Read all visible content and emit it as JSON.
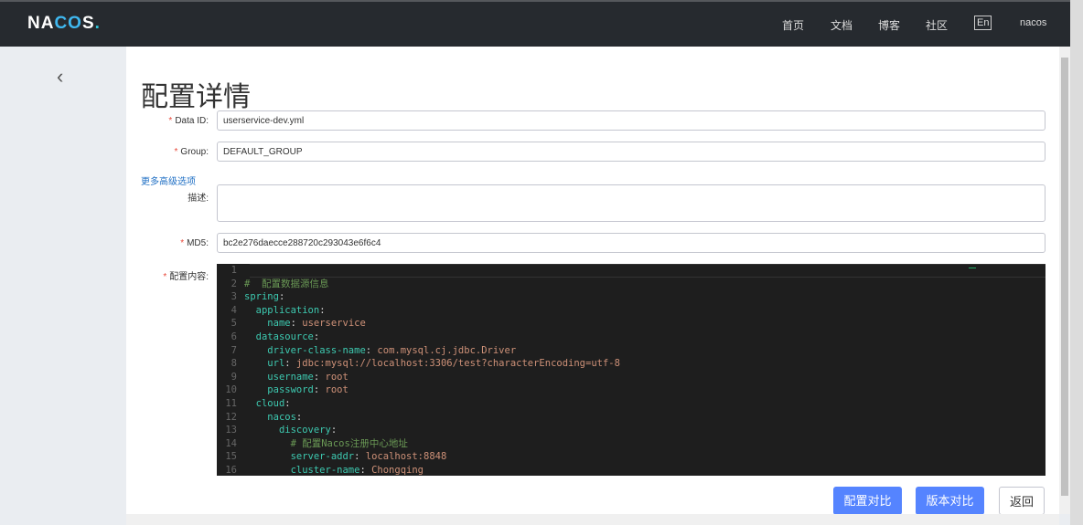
{
  "header": {
    "logo": "NACOS.",
    "nav": [
      "首页",
      "文档",
      "博客",
      "社区"
    ],
    "lang": "En",
    "user": "nacos"
  },
  "page": {
    "title": "配置详情",
    "more_options": "更多高级选项"
  },
  "form": {
    "data_id": {
      "label": "Data ID:",
      "value": "userservice-dev.yml"
    },
    "group": {
      "label": "Group:",
      "value": "DEFAULT_GROUP"
    },
    "desc": {
      "label": "描述:",
      "value": ""
    },
    "md5": {
      "label": "MD5:",
      "value": "bc2e276daecce288720c293043e6f6c4"
    },
    "content": {
      "label": "配置内容:"
    }
  },
  "code": [
    {
      "n": "1",
      "i": "",
      "k": "",
      "v": "",
      "c": ""
    },
    {
      "n": "2",
      "i": "",
      "k": "",
      "v": "",
      "c": "#  配置数据源信息"
    },
    {
      "n": "3",
      "i": "",
      "k": "spring",
      "v": "",
      "c": ""
    },
    {
      "n": "4",
      "i": "  ",
      "k": "application",
      "v": "",
      "c": ""
    },
    {
      "n": "5",
      "i": "    ",
      "k": "name",
      "v": "userservice",
      "c": ""
    },
    {
      "n": "6",
      "i": "  ",
      "k": "datasource",
      "v": "",
      "c": ""
    },
    {
      "n": "7",
      "i": "    ",
      "k": "driver-class-name",
      "v": "com.mysql.cj.jdbc.Driver",
      "c": ""
    },
    {
      "n": "8",
      "i": "    ",
      "k": "url",
      "v": "jdbc:mysql://localhost:3306/test?characterEncoding=utf-8",
      "c": ""
    },
    {
      "n": "9",
      "i": "    ",
      "k": "username",
      "v": "root",
      "c": ""
    },
    {
      "n": "10",
      "i": "    ",
      "k": "password",
      "v": "root",
      "c": ""
    },
    {
      "n": "11",
      "i": "  ",
      "k": "cloud",
      "v": "",
      "c": ""
    },
    {
      "n": "12",
      "i": "    ",
      "k": "nacos",
      "v": "",
      "c": ""
    },
    {
      "n": "13",
      "i": "      ",
      "k": "discovery",
      "v": "",
      "c": ""
    },
    {
      "n": "14",
      "i": "        ",
      "k": "",
      "v": "",
      "c": "# 配置Nacos注册中心地址"
    },
    {
      "n": "15",
      "i": "        ",
      "k": "server-addr",
      "v": "localhost:8848",
      "c": ""
    },
    {
      "n": "16",
      "i": "        ",
      "k": "cluster-name",
      "v": "Chongqing",
      "c": ""
    }
  ],
  "buttons": {
    "config_compare": "配置对比",
    "version_compare": "版本对比",
    "back": "返回"
  }
}
